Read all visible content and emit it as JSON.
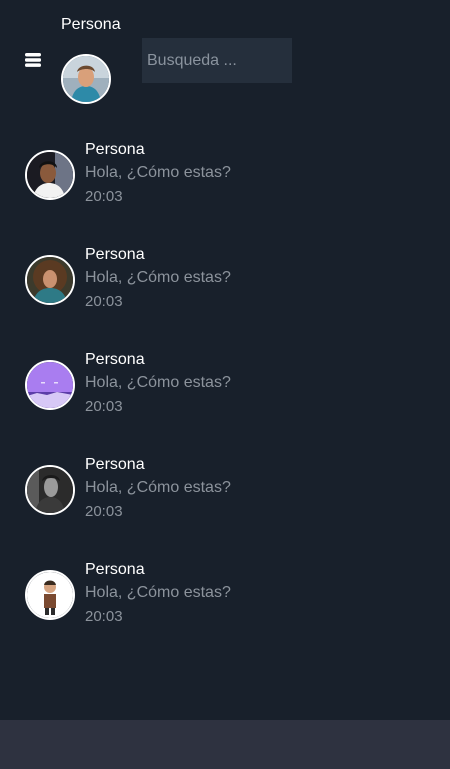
{
  "header": {
    "profile_name": "Persona",
    "menu_icon": "hamburger-icon",
    "search": {
      "placeholder": "Busqueda ...",
      "value": ""
    }
  },
  "chats": [
    {
      "name": "Persona",
      "message": "Hola, ¿Cómo estas?",
      "time": "20:03"
    },
    {
      "name": "Persona",
      "message": "Hola, ¿Cómo estas?",
      "time": "20:03"
    },
    {
      "name": "Persona",
      "message": "Hola, ¿Cómo estas?",
      "time": "20:03"
    },
    {
      "name": "Persona",
      "message": "Hola, ¿Cómo estas?",
      "time": "20:03"
    },
    {
      "name": "Persona",
      "message": "Hola, ¿Cómo estas?",
      "time": "20:03"
    }
  ],
  "colors": {
    "background": "#18202b",
    "search_bg": "#252f3c",
    "bottom_bar": "#2e3240",
    "text_primary": "#ffffff",
    "text_secondary": "#8c939c"
  }
}
